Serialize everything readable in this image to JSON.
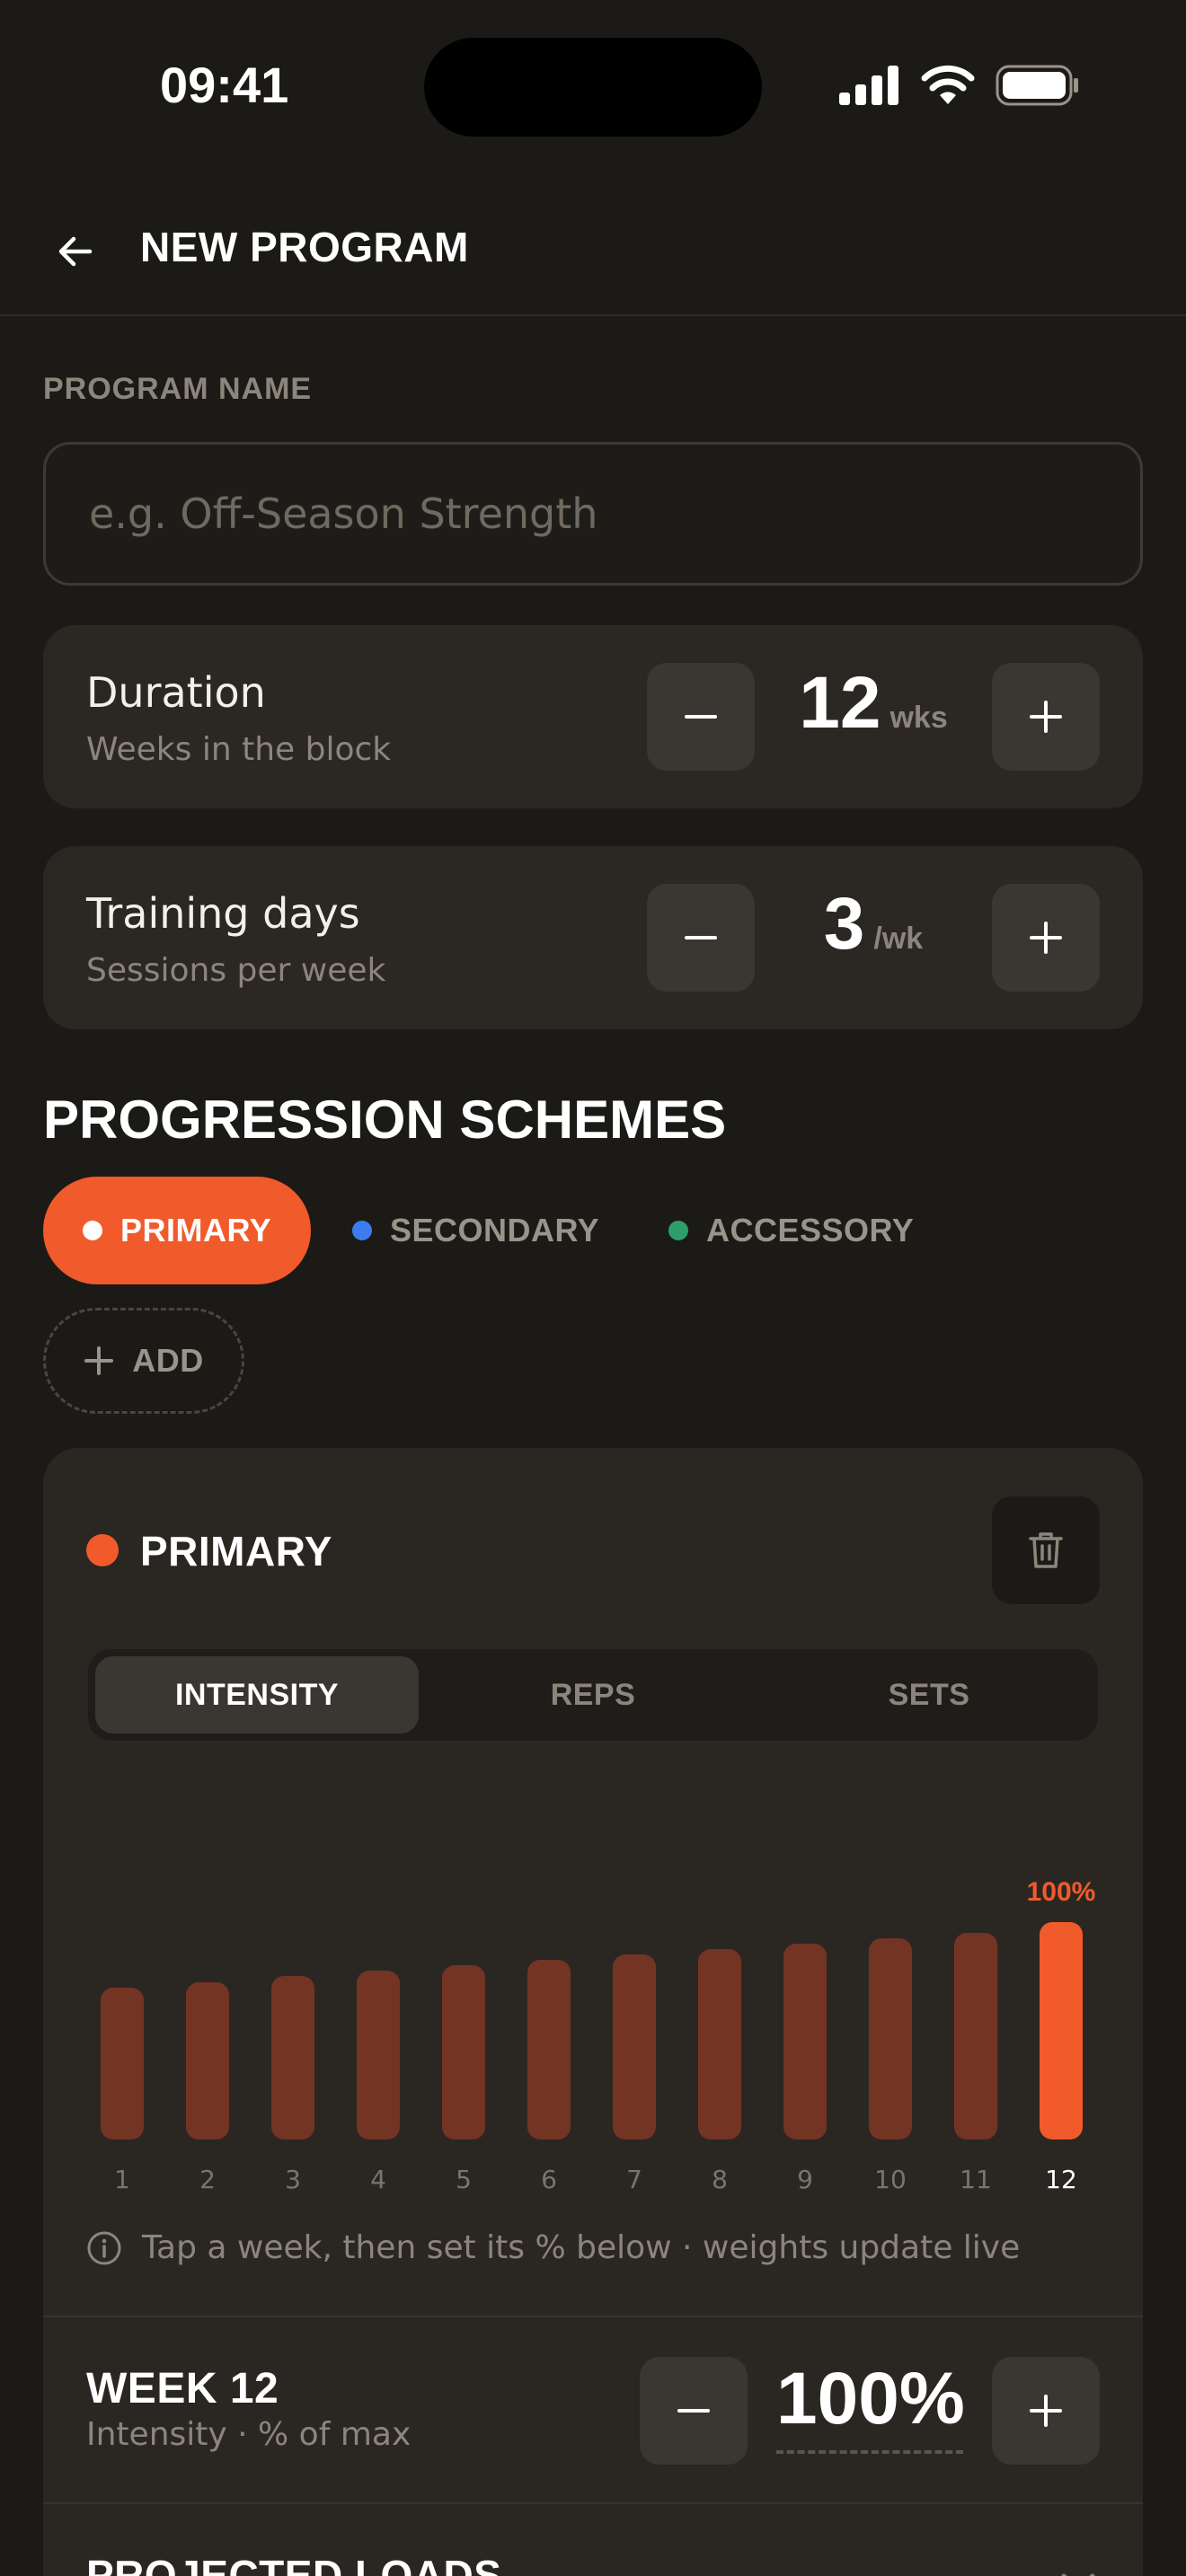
{
  "status_bar": {
    "time": "09:41"
  },
  "header": {
    "title": "NEW PROGRAM"
  },
  "program_name": {
    "label": "PROGRAM NAME",
    "value": "",
    "placeholder": "e.g. Off-Season Strength"
  },
  "duration": {
    "title": "Duration",
    "subtitle": "Weeks in the block",
    "value": "12",
    "unit": "wks"
  },
  "training_days": {
    "title": "Training days",
    "subtitle": "Sessions per week",
    "value": "3",
    "unit": "/wk"
  },
  "schemes": {
    "title": "PROGRESSION SCHEMES",
    "chips": [
      {
        "label": "PRIMARY",
        "color": "#f15a2b",
        "active": true
      },
      {
        "label": "SECONDARY",
        "color": "#3b7cf0",
        "active": false
      },
      {
        "label": "ACCESSORY",
        "color": "#2e9e6a",
        "active": false
      }
    ],
    "add_label": "ADD"
  },
  "panel": {
    "title": "PRIMARY",
    "accent": "#f15a2b",
    "tabs": [
      "INTENSITY",
      "REPS",
      "SETS"
    ],
    "active_tab": 0,
    "hint": "Tap a week, then set its % below · weights update live",
    "week": {
      "title": "WEEK 12",
      "subtitle": "Intensity · % of max",
      "value": "100%"
    },
    "projected_title": "PROJECTED LOADS"
  },
  "chart_data": {
    "type": "bar",
    "categories": [
      "1",
      "2",
      "3",
      "4",
      "5",
      "6",
      "7",
      "8",
      "9",
      "10",
      "11",
      "12"
    ],
    "values": [
      70,
      72.5,
      75,
      77.5,
      80,
      82.5,
      85,
      87.5,
      90,
      92.5,
      95,
      100
    ],
    "selected_index": 11,
    "selected_label": "100%",
    "ylim": [
      0,
      100
    ],
    "colors": {
      "bar": "#733424",
      "selected": "#f15a2b"
    }
  }
}
